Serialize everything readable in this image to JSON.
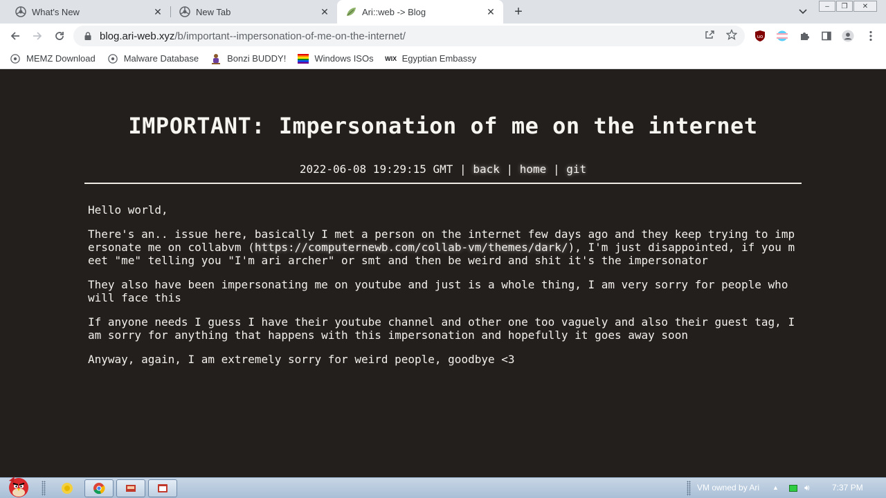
{
  "browser": {
    "tabs": [
      {
        "title": "What's New",
        "active": false,
        "icon": "chrome-globe-icon"
      },
      {
        "title": "New Tab",
        "active": false,
        "icon": "chrome-globe-icon"
      },
      {
        "title": "Ari::web -> Blog",
        "active": true,
        "icon": "leaf-favicon-icon"
      }
    ],
    "new_tab_label": "+",
    "url": {
      "host": "blog.ari-web.xyz",
      "path": "/b/important--impersonation-of-me-on-the-internet/"
    }
  },
  "bookmarks": [
    {
      "label": "MEMZ Download",
      "icon": "globe-icon"
    },
    {
      "label": "Malware Database",
      "icon": "globe-icon"
    },
    {
      "label": "Bonzi BUDDY!",
      "icon": "bonzi-icon"
    },
    {
      "label": "Windows ISOs",
      "icon": "rainbow-flag-icon"
    },
    {
      "label": "Egyptian Embassy",
      "icon": "wix-icon"
    }
  ],
  "post": {
    "title": "IMPORTANT: Impersonation of me on the internet",
    "date": "2022-06-08 19:29:15 GMT",
    "sep": "|",
    "links": {
      "back": "back",
      "home": "home",
      "git": "git"
    },
    "paragraphs": {
      "p1": "Hello world,",
      "p2_before": "There's an.. issue here, basically I met a person on the internet few days ago and they keep trying to impersonate me on collabvm (",
      "p2_link": "https://computernewb.com/collab-vm/themes/dark/",
      "p2_after": "), I'm just disappointed, if you meet \"me\" telling you \"I'm ari archer\" or smt and then be weird and shit it's the impersonator",
      "p3": "They also have been impersonating me on youtube and just is a whole thing, I am very sorry for people who will face this",
      "p4": "If anyone needs I guess I have their youtube channel and other one too vaguely and also their guest tag, I am sorry for anything that happens with this impersonation and hopefully it goes away soon",
      "p5": "Anyway, again, I am extremely sorry for weird people, goodbye <3"
    }
  },
  "taskbar": {
    "tray_text": "VM owned by Ari",
    "clock": "7:37 PM"
  },
  "colors": {
    "page_bg": "#231f1d",
    "page_fg": "#f3f1ec"
  }
}
